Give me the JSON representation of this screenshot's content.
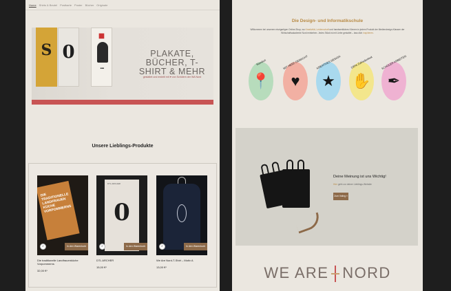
{
  "left": {
    "nav": [
      "Home",
      "Shirts & Beutel",
      "Postkarte",
      "Poster",
      "Bücher",
      "Originale"
    ],
    "hero": {
      "title": "PLAKATE, BÜCHER, T-SHIRT & MEHR",
      "subtitle": "gestaltet und erstellt mit ♥ von Schülern der WA Nord"
    },
    "section_title": "Unsere Lieblings-Produkte",
    "products": [
      {
        "name": "Die traditionelle Landfrauenküche Vorpommerns",
        "price": "32,00 €*",
        "cart": "In den Warenkorb",
        "image_text": "DIE TRADITIONELLE LANDFRAUEN KÜCHE VORPOMMERNS"
      },
      {
        "name": "DTL ARCHER",
        "price": "15,00 €*",
        "cart": "In den Warenkorb",
        "image_text": "DTL ARCHER"
      },
      {
        "name": "We Are Nord-T-Shirt – Motiv A",
        "price": "13,00 €*",
        "cart": "In den Warenkorb"
      }
    ]
  },
  "right": {
    "title": "Die Design- und Informatikschule",
    "text_1": "Willkommen bei unserem einzigartigen Online-Shop, wo ",
    "link_1": "Kreativität, Leidenschaft",
    "text_2": " und handwerkliches Können in jedem Produkt der Mediendesign-Klassen der Wirtschaftsakademie Nord entstehen. Jedes Stück ist mit Liebe gestaltet – lass dich ",
    "link_2": "inspirieren",
    "text_3": ".",
    "icons": [
      {
        "caption": "Standort"
      },
      {
        "caption": "MIT HERZ GEMACHT"
      },
      {
        "caption": "KREATIVES DESIGN"
      },
      {
        "caption": "100% Zufriedenheit"
      },
      {
        "caption": "SCHÜLER ARBEITEN"
      }
    ],
    "feedback": {
      "title": "Deine Meinung ist uns Wichtig!",
      "text_link": "Hier",
      "text": " geht zur deiner Lieblings-Website",
      "button": "Zum Voting »"
    },
    "brand": [
      "WE ARE",
      "NORD"
    ]
  },
  "colors": {
    "accent": "#b88a45",
    "button": "#8d6a49",
    "hero_bar": "#c85454"
  }
}
